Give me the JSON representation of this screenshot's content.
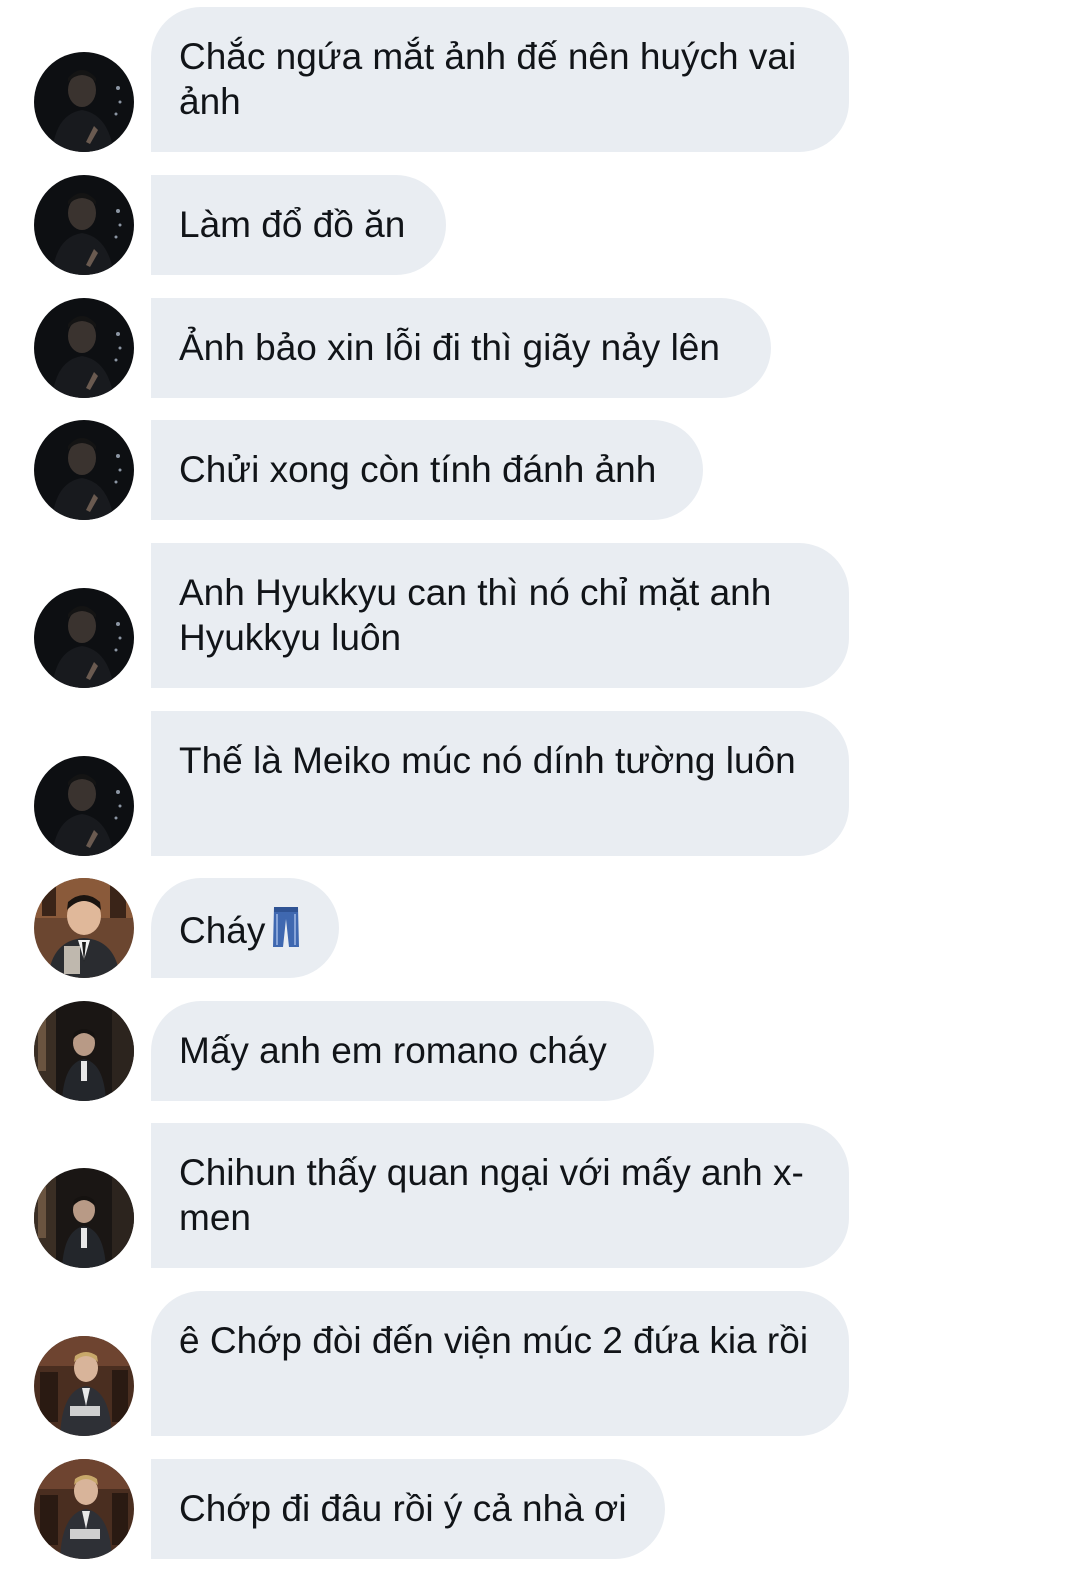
{
  "colors": {
    "bubble_bg": "#e9edf2",
    "text": "#111418",
    "background": "#ffffff"
  },
  "messages": [
    {
      "sender": "user-a",
      "text": "Chắc ngứa mắt ảnh đế nên huých vai ảnh"
    },
    {
      "sender": "user-a",
      "text": "Làm đổ đồ ăn"
    },
    {
      "sender": "user-a",
      "text": "Ảnh bảo xin lỗi đi thì giãy nảy lên"
    },
    {
      "sender": "user-a",
      "text": "Chửi xong còn tính đánh ảnh"
    },
    {
      "sender": "user-a",
      "text": "Anh Hyukkyu can thì nó chỉ mặt anh Hyukkyu luôn"
    },
    {
      "sender": "user-a",
      "text": "Thế là Meiko múc nó dính tường luôn"
    },
    {
      "sender": "user-b",
      "text": "Cháy",
      "emoji": "jeans-icon"
    },
    {
      "sender": "user-c",
      "text": "Mấy anh em romano cháy"
    },
    {
      "sender": "user-c",
      "text": "Chihun thấy quan ngại với mấy anh x-men"
    },
    {
      "sender": "user-d",
      "text": "ê Chớp đòi đến viện múc 2 đứa kia rồi"
    },
    {
      "sender": "user-d",
      "text": "Chớp đi đâu rồi ý cả nhà ơi"
    }
  ]
}
